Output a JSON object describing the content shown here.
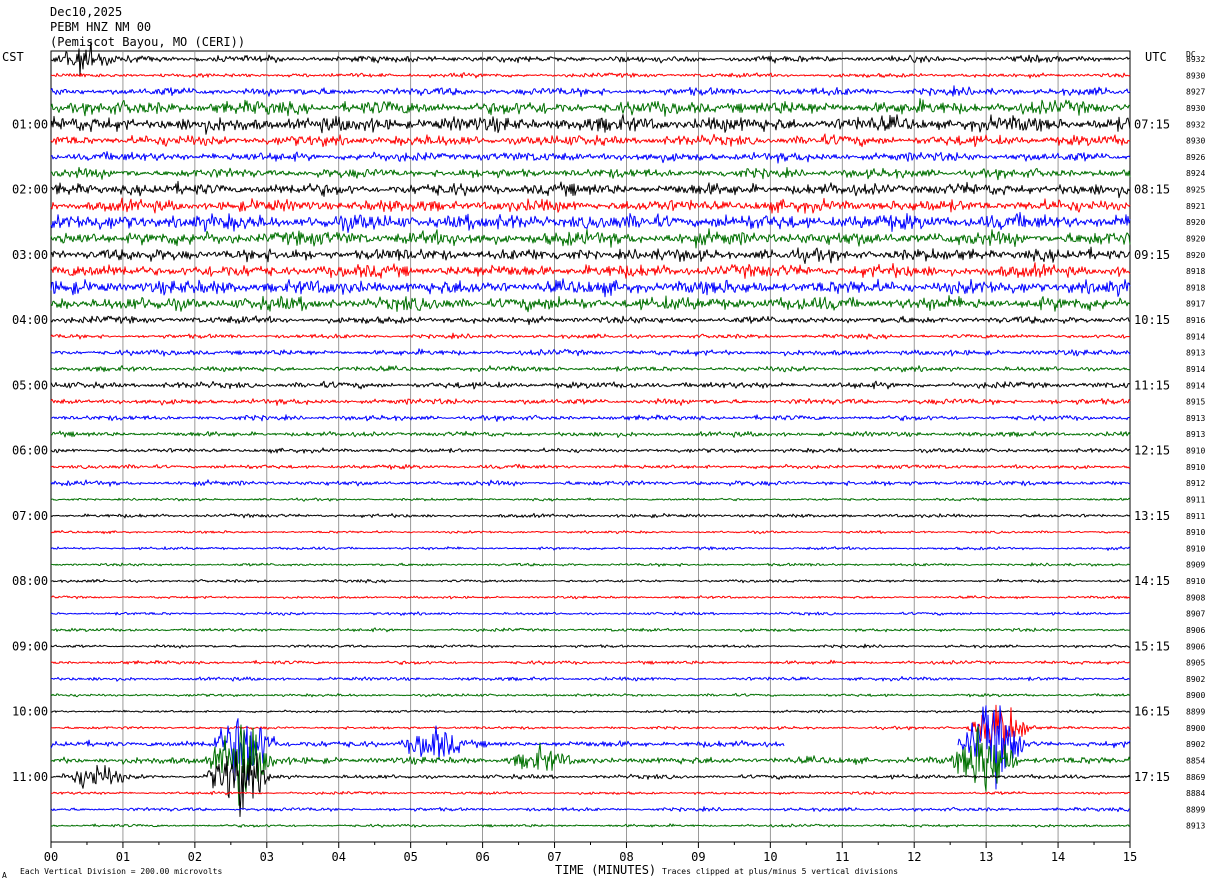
{
  "header": {
    "date": "Dec10,2025",
    "station": "PEBM HNZ NM 00",
    "location": "(Pemiscot Bayou, MO (CERI))"
  },
  "left_axis_title": "CST",
  "right_axis_title": "UTC",
  "dc_title": "DC",
  "x_axis_title": "TIME (MINUTES)",
  "footer": {
    "left_mark": "A",
    "division_note": "Each Vertical Division =  200.00 microvolts",
    "clip_note": "Traces clipped at plus/minus 5 vertical divisions"
  },
  "colors": {
    "trace_cycle": [
      "#000000",
      "#ff0000",
      "#0000ff",
      "#007000"
    ],
    "grid": "#808080"
  },
  "chart_data": {
    "type": "line",
    "title": "",
    "xlabel": "TIME (MINUTES)",
    "xlim": [
      0,
      15
    ],
    "x_ticks": [
      "00",
      "01",
      "02",
      "03",
      "04",
      "05",
      "06",
      "07",
      "08",
      "09",
      "10",
      "11",
      "12",
      "13",
      "14",
      "15"
    ],
    "trace_minutes": 15,
    "left_time_labels": [
      "01:00",
      "02:00",
      "03:00",
      "04:00",
      "05:00",
      "06:00",
      "07:00",
      "08:00",
      "09:00",
      "10:00",
      "11:00"
    ],
    "right_time_labels": [
      "07:15",
      "08:15",
      "09:15",
      "10:15",
      "11:15",
      "12:15",
      "13:15",
      "14:15",
      "15:15",
      "16:15",
      "17:15"
    ],
    "dc_offsets": [
      8932,
      8930,
      8927,
      8930,
      8932,
      8930,
      8926,
      8924,
      8925,
      8921,
      8920,
      8920,
      8920,
      8918,
      8918,
      8917,
      8916,
      8914,
      8913,
      8914,
      8914,
      8915,
      8913,
      8913,
      8910,
      8910,
      8912,
      8911,
      8911,
      8910,
      8910,
      8909,
      8910,
      8908,
      8907,
      8906,
      8906,
      8905,
      8902,
      8900,
      8899,
      8900,
      8902,
      8854,
      8869,
      8884,
      8899,
      8913
    ],
    "trace_activity": [
      0.9,
      0.6,
      1.1,
      1.9,
      2.1,
      1.5,
      1.3,
      1.3,
      1.7,
      1.7,
      2.2,
      2.0,
      1.7,
      1.8,
      2.0,
      1.9,
      1.0,
      0.6,
      0.8,
      0.7,
      0.9,
      0.8,
      0.7,
      0.7,
      0.6,
      0.6,
      0.7,
      0.35,
      0.5,
      0.35,
      0.4,
      0.4,
      0.4,
      0.35,
      0.4,
      0.45,
      0.4,
      0.5,
      0.5,
      0.4,
      0.35,
      0.4,
      0.9,
      1.0,
      0.6,
      0.4,
      0.5,
      0.4
    ],
    "events": [
      {
        "trace": 0,
        "minute": 0.45,
        "amplitude": 2.0
      },
      {
        "trace": 42,
        "minute": 2.7,
        "amplitude": 6.0
      },
      {
        "trace": 43,
        "minute": 2.65,
        "amplitude": 6.0
      },
      {
        "trace": 44,
        "minute": 2.6,
        "amplitude": 5.0
      },
      {
        "trace": 44,
        "minute": 0.6,
        "amplitude": 2.0
      },
      {
        "trace": 42,
        "minute": 13.1,
        "amplitude": 6.0
      },
      {
        "trace": 43,
        "minute": 13.0,
        "amplitude": 6.0
      },
      {
        "trace": 41,
        "minute": 13.2,
        "amplitude": 4.0
      },
      {
        "trace": 42,
        "minute": 5.3,
        "amplitude": 2.5
      },
      {
        "trace": 43,
        "minute": 6.8,
        "amplitude": 1.5
      }
    ],
    "gaps": [
      {
        "trace": 42,
        "from": 10.2,
        "to": 12.6
      }
    ]
  }
}
